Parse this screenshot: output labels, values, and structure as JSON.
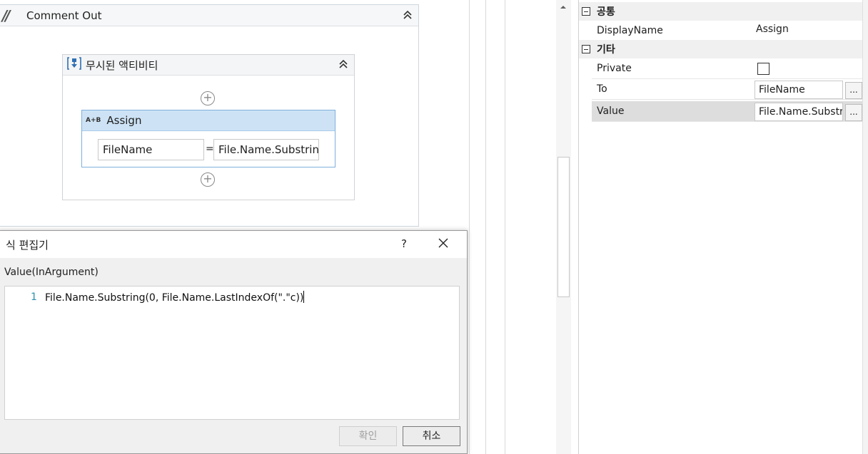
{
  "designer": {
    "comment_out": {
      "title": "Comment Out"
    },
    "ignored_activities": {
      "title": "무시된 액티비티"
    },
    "assign": {
      "title": "Assign",
      "icon_text": "A+B",
      "to_value": "FileName",
      "equals": "=",
      "value_text": "File.Name.Substrin"
    }
  },
  "dialog": {
    "title": "식 편집기",
    "help": "?",
    "label": "Value(InArgument)",
    "line_number": "1",
    "code": "File.Name.Substring(0, File.Name.LastIndexOf(\".\"c))",
    "ok_label": "확인",
    "cancel_label": "취소"
  },
  "properties": {
    "categories": [
      {
        "name": "공통"
      },
      {
        "name": "기타"
      }
    ],
    "rows": {
      "display_name": {
        "label": "DisplayName",
        "value": "Assign"
      },
      "private": {
        "label": "Private",
        "checked": false
      },
      "to": {
        "label": "To",
        "value": "FileName",
        "button": "..."
      },
      "value": {
        "label": "Value",
        "value": "File.Name.Substri",
        "button": "..."
      }
    }
  }
}
